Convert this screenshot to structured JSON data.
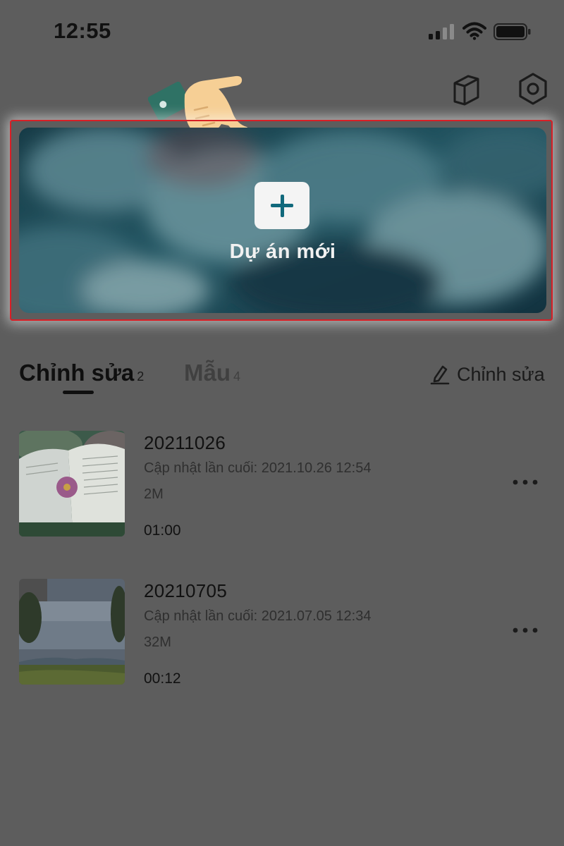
{
  "status_bar": {
    "time": "12:55"
  },
  "header": {
    "icons": [
      "book-icon",
      "settings-icon"
    ]
  },
  "banner": {
    "label": "Dự án mới",
    "highlight_color": "#d81f26",
    "accent_color": "#11697c"
  },
  "tabs": {
    "edit": {
      "label": "Chỉnh sửa",
      "count": "2",
      "active": true
    },
    "templates": {
      "label": "Mẫu",
      "count": "4",
      "active": false
    },
    "edit_action_label": "Chỉnh sửa"
  },
  "projects": [
    {
      "name": "20211026",
      "updated": "Cập nhật lần cuối: 2021.10.26 12:54",
      "size": "2M",
      "duration": "01:00"
    },
    {
      "name": "20210705",
      "updated": "Cập nhật lần cuối: 2021.07.05 12:34",
      "size": "32M",
      "duration": "00:12"
    }
  ],
  "colors": {
    "overlay_bg": "#5d5d5d",
    "text": "#1a1a1a"
  }
}
